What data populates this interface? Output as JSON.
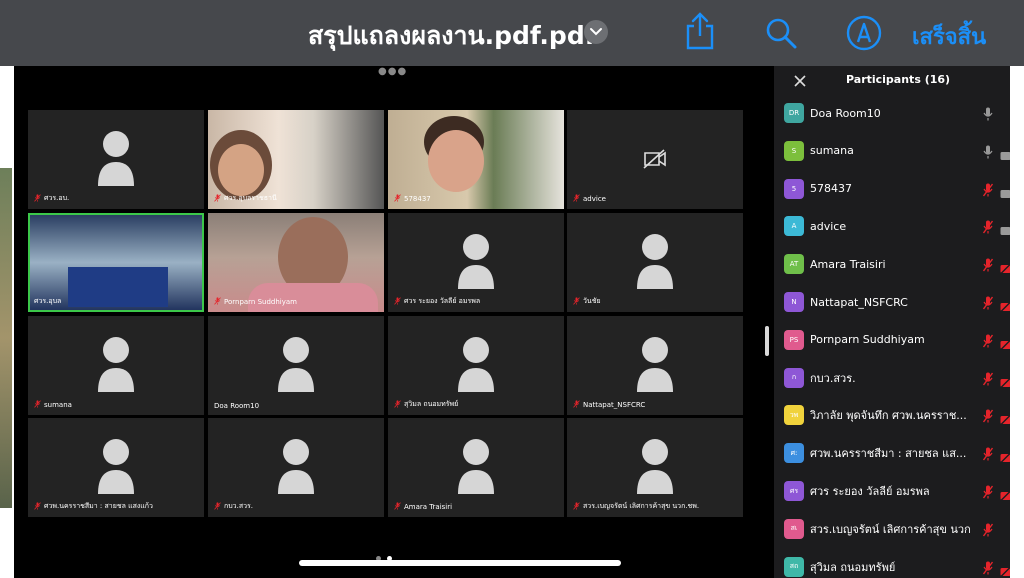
{
  "topbar": {
    "title": "สรุปแถลงผลงาน.pdf.pdf",
    "done_label": "เสร็จสิ้น",
    "icons": [
      "share-icon",
      "search-icon",
      "markup-icon",
      "chevron-down-icon"
    ]
  },
  "meeting": {
    "tiles": [
      {
        "label": "ศวร.อบ.",
        "mic_muted": true,
        "type": "avatar"
      },
      {
        "label": "ศวร.อุบลราชธานี",
        "mic_muted": true,
        "type": "video"
      },
      {
        "label": "578437",
        "mic_muted": true,
        "type": "video"
      },
      {
        "label": "advice",
        "mic_muted": true,
        "type": "camera-off"
      },
      {
        "label": "ศวร.อุบล",
        "mic_muted": false,
        "type": "video",
        "active": true
      },
      {
        "label": "Pornparn Suddhiyam",
        "mic_muted": true,
        "type": "video"
      },
      {
        "label": "ศวร ระยอง วัลลีย์ อมรพล",
        "mic_muted": true,
        "type": "avatar"
      },
      {
        "label": "วันชัย",
        "mic_muted": true,
        "type": "avatar"
      },
      {
        "label": "sumana",
        "mic_muted": true,
        "type": "avatar"
      },
      {
        "label": "Doa Room10",
        "mic_muted": false,
        "type": "avatar"
      },
      {
        "label": "สุวิมล ถนอมทรัพย์",
        "mic_muted": true,
        "type": "avatar"
      },
      {
        "label": "Nattapat_NSFCRC",
        "mic_muted": true,
        "type": "avatar"
      },
      {
        "label": "ศวพ.นครราชสีมา : สายชล แสงแก้ว",
        "mic_muted": true,
        "type": "avatar"
      },
      {
        "label": "กบว.สวร.",
        "mic_muted": true,
        "type": "avatar"
      },
      {
        "label": "Amara Traisiri",
        "mic_muted": true,
        "type": "avatar"
      },
      {
        "label": "สวร.เบญจรัตน์ เลิศการค้าสุข นวก.ชพ.",
        "mic_muted": true,
        "type": "avatar"
      }
    ]
  },
  "participants": {
    "title": "Participants (16)",
    "items": [
      {
        "initials": "DR",
        "name": "Doa Room10",
        "color": "#3fa6a0",
        "mic": "on",
        "cam": "none"
      },
      {
        "initials": "S",
        "name": "sumana",
        "color": "#7cbf3c",
        "mic": "on",
        "cam": "on"
      },
      {
        "initials": "5",
        "name": "578437",
        "color": "#8e57d6",
        "mic": "off",
        "cam": "on"
      },
      {
        "initials": "A",
        "name": "advice",
        "color": "#3cb9d6",
        "mic": "off",
        "cam": "on"
      },
      {
        "initials": "AT",
        "name": "Amara Traisiri",
        "color": "#6fbf4a",
        "mic": "off",
        "cam": "off"
      },
      {
        "initials": "N",
        "name": "Nattapat_NSFCRC",
        "color": "#8e57d6",
        "mic": "off",
        "cam": "off"
      },
      {
        "initials": "PS",
        "name": "Pornparn Suddhiyam",
        "color": "#e05a8e",
        "mic": "off",
        "cam": "off"
      },
      {
        "initials": "ก",
        "name": "กบว.สวร.",
        "color": "#8e57d6",
        "mic": "off",
        "cam": "off"
      },
      {
        "initials": "วพ",
        "name": "วิภาลัย พุดจันทึก ศวพ.นครราช...",
        "color": "#f0d23c",
        "mic": "off",
        "cam": "off"
      },
      {
        "initials": "ศ:",
        "name": "ศวพ.นครราชสีมา : สายชล แส...",
        "color": "#3c8fe0",
        "mic": "off",
        "cam": "off"
      },
      {
        "initials": "ศร",
        "name": "ศวร ระยอง วัลลีย์ อมรพล",
        "color": "#8e57d6",
        "mic": "off",
        "cam": "off"
      },
      {
        "initials": "สเ",
        "name": "สวร.เบญจรัตน์ เลิศการค้าสุข นวก...",
        "color": "#e05a8e",
        "mic": "off",
        "cam": "none"
      },
      {
        "initials": "สถ",
        "name": "สุวิมล ถนอมทรัพย์",
        "color": "#3fb8a8",
        "mic": "off",
        "cam": "off"
      }
    ]
  },
  "colors": {
    "accent": "#1b8ff8",
    "muted_red": "#e5242b",
    "active_green": "#3cc84a"
  }
}
